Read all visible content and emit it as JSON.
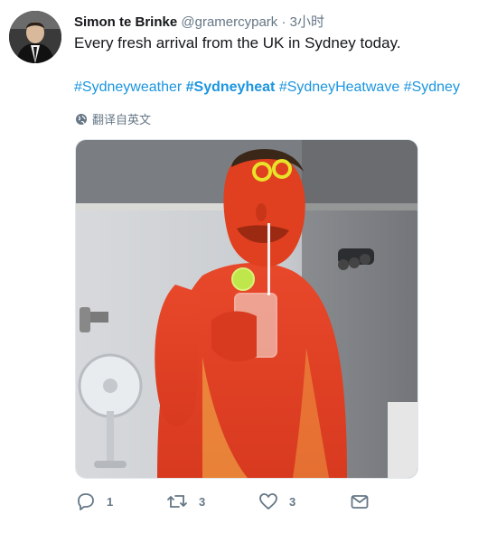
{
  "tweet": {
    "author_name": "Simon te Brinke",
    "handle": "@gramercypark",
    "separator": "·",
    "time": "3小时",
    "text": "Every fresh arrival from the UK in Sydney today.",
    "hashtags": [
      {
        "text": "#Sydneyweather",
        "bold": false
      },
      {
        "text": "#Sydneyheat",
        "bold": true
      },
      {
        "text": "#SydneyHeatwave",
        "bold": false
      },
      {
        "text": "#Sydney",
        "bold": false
      }
    ],
    "translate_label": "翻译自英文"
  },
  "actions": {
    "reply_count": "1",
    "retweet_count": "3",
    "like_count": "3"
  },
  "icons": {
    "reply": "reply-icon",
    "retweet": "retweet-icon",
    "like": "heart-icon",
    "dm": "envelope-icon",
    "translate": "globe-icon"
  },
  "colors": {
    "link": "#1b95e0",
    "muted": "#657786",
    "text": "#14171a"
  }
}
